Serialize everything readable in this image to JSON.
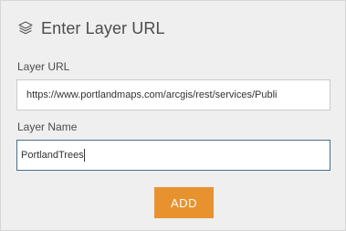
{
  "dialog": {
    "title": "Enter Layer URL",
    "icon": "layers-icon",
    "accent_color": "#e8922f",
    "focus_border_color": "#4b6f8c"
  },
  "fields": {
    "url": {
      "label": "Layer URL",
      "value": "https://www.portlandmaps.com/arcgis/rest/services/Publi"
    },
    "name": {
      "label": "Layer Name",
      "value": "PortlandTrees"
    }
  },
  "actions": {
    "add_label": "ADD"
  }
}
